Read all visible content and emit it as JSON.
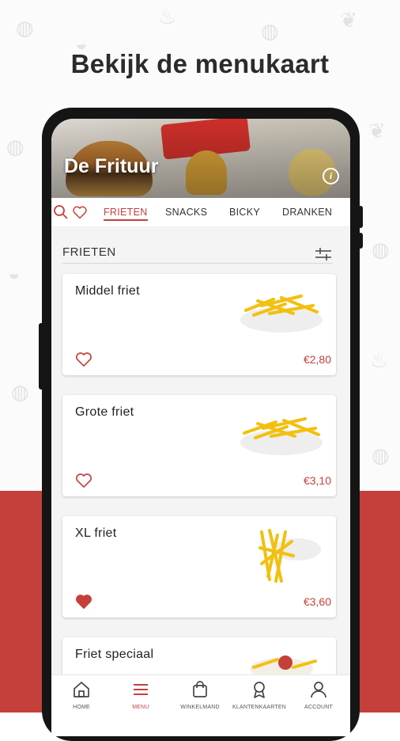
{
  "headline": "Bekijk de menukaart",
  "restaurant": {
    "name": "De Frituur"
  },
  "tabs": [
    {
      "label": "FRIETEN",
      "active": true
    },
    {
      "label": "SNACKS",
      "active": false
    },
    {
      "label": "BICKY",
      "active": false
    },
    {
      "label": "DRANKEN",
      "active": false
    }
  ],
  "section": {
    "title": "FRIETEN"
  },
  "products": [
    {
      "name": "Middel friet",
      "price": "€2,80",
      "favorite": false
    },
    {
      "name": "Grote friet",
      "price": "€3,10",
      "favorite": false
    },
    {
      "name": "XL friet",
      "price": "€3,60",
      "favorite": true
    },
    {
      "name": "Friet speciaal",
      "price": "",
      "favorite": false
    }
  ],
  "bottom_nav": [
    {
      "label": "HOME",
      "icon": "home-icon",
      "active": false
    },
    {
      "label": "MENU",
      "icon": "menu-icon",
      "active": true
    },
    {
      "label": "WINKELMAND",
      "icon": "basket-icon",
      "active": false
    },
    {
      "label": "KLANTENKAARTEN",
      "icon": "award-icon",
      "active": false
    },
    {
      "label": "ACCOUNT",
      "icon": "account-icon",
      "active": false
    }
  ],
  "colors": {
    "brand": "#c5403a",
    "background": "#fbfbfb",
    "text": "#222222"
  }
}
